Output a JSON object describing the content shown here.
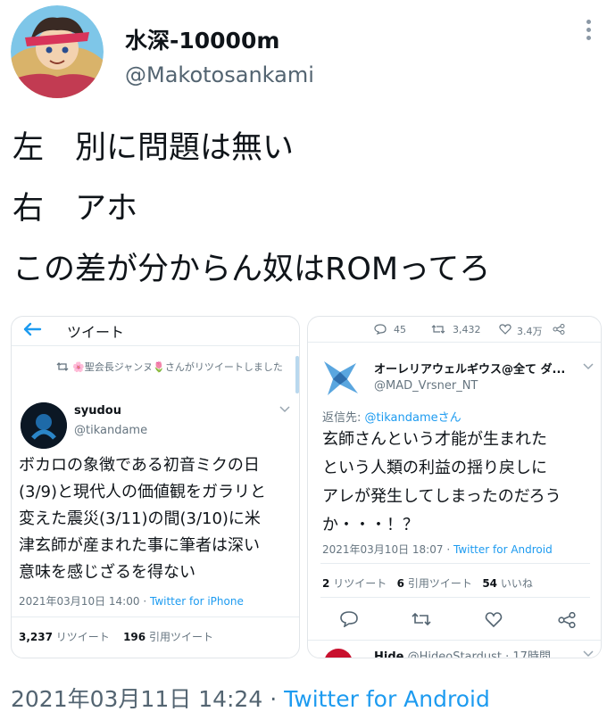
{
  "author": {
    "display_name": "水深-10000m",
    "handle": "@Makotosankami",
    "avatar_icon": "anime-character-avatar"
  },
  "tweet": {
    "lines": [
      "左　別に問題は無い",
      "右　アホ",
      "この差が分からん奴はROMってろ"
    ],
    "date": "2021年03月11日 14:24",
    "separator": "·",
    "source": "Twitter for Android"
  },
  "left_screenshot": {
    "header_title": "ツイート",
    "retweet_note": "🌸聖会長ジャンヌ🌷さんがリツイートしました",
    "name": "syudou",
    "handle": "@tikandame",
    "body_lines": [
      "ボカロの象徴である初音ミクの日",
      "(3/9)と現代人の価値観をガラリと",
      "変えた震災(3/11)の間(3/10)に米",
      "津玄師が産まれた事に筆者は深い",
      "意味を感じざるを得ない"
    ],
    "meta_date": "2021年03月10日 14:00",
    "meta_source": "Twitter for iPhone",
    "retweets_count": "3,237",
    "retweets_label": "リツイート",
    "quotes_count": "196",
    "quotes_label": "引用ツイート"
  },
  "right_screenshot": {
    "top_actions": {
      "replies": "45",
      "retweets": "3,432",
      "likes": "3.4万"
    },
    "name": "オーレリアウェルギウス@全て ダ...",
    "handle": "@MAD_Vrsner_NT",
    "reply_prefix": "返信先:",
    "reply_handle": "@tikandameさん",
    "body_lines": [
      "玄師さんという才能が生まれた",
      "という人類の利益の揺り戻しに",
      "アレが発生してしまったのだろう",
      "か・・・！？"
    ],
    "meta_date": "2021年03月10日 18:07",
    "meta_source": "Twitter for Android",
    "retweets_count": "2",
    "retweets_label": "リツイート",
    "quotes_count": "6",
    "quotes_label": "引用ツイート",
    "likes_count": "54",
    "likes_label": "いいね",
    "next_name": "Hide",
    "next_handle": "@HideoStardust",
    "next_time": "· 17時間"
  },
  "colors": {
    "link_blue": "#1d9bf0",
    "secondary_gray": "#536471"
  }
}
